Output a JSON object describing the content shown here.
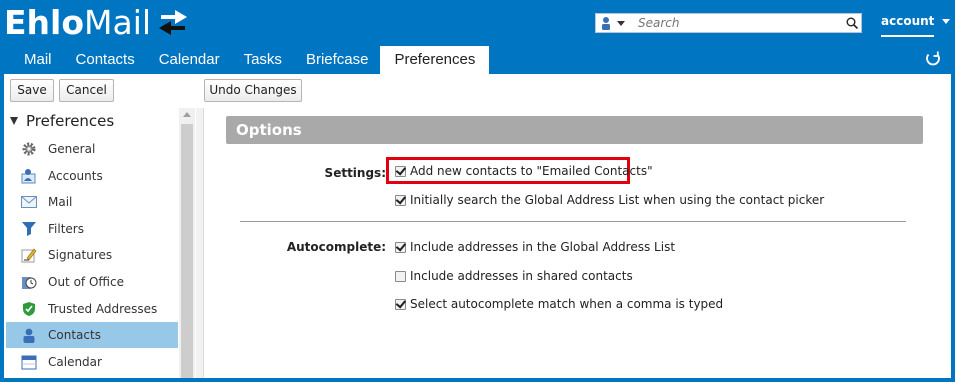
{
  "app": {
    "logo_text_bold": "Ehlo",
    "logo_text_thin": "Mail",
    "brand_color": "#0075c2"
  },
  "search": {
    "placeholder": "Search"
  },
  "account": {
    "label": "account"
  },
  "tabs": [
    {
      "label": "Mail"
    },
    {
      "label": "Contacts"
    },
    {
      "label": "Calendar"
    },
    {
      "label": "Tasks"
    },
    {
      "label": "Briefcase"
    },
    {
      "label": "Preferences",
      "active": true
    }
  ],
  "toolbar": {
    "save_label": "Save",
    "cancel_label": "Cancel",
    "undo_label": "Undo Changes"
  },
  "sidebar": {
    "title": "Preferences",
    "items": [
      {
        "label": "General",
        "icon": "gear-icon"
      },
      {
        "label": "Accounts",
        "icon": "accounts-icon"
      },
      {
        "label": "Mail",
        "icon": "envelope-icon"
      },
      {
        "label": "Filters",
        "icon": "filter-icon"
      },
      {
        "label": "Signatures",
        "icon": "pen-icon"
      },
      {
        "label": "Out of Office",
        "icon": "clock-icon"
      },
      {
        "label": "Trusted Addresses",
        "icon": "shield-icon"
      },
      {
        "label": "Contacts",
        "icon": "contact-icon",
        "selected": true
      },
      {
        "label": "Calendar",
        "icon": "calendar-icon"
      }
    ]
  },
  "options": {
    "title": "Options",
    "settings_label": "Settings:",
    "settings": [
      {
        "label": "Add new contacts to \"Emailed Contacts\"",
        "checked": true
      },
      {
        "label": "Initially search the Global Address List when using the contact picker",
        "checked": true
      }
    ],
    "autocomplete_label": "Autocomplete:",
    "autocomplete": [
      {
        "label": "Include addresses in the Global Address List",
        "checked": true
      },
      {
        "label": "Include addresses in shared contacts",
        "checked": false
      },
      {
        "label": "Select autocomplete match when a comma is typed",
        "checked": true
      }
    ],
    "highlight_color": "#e1000f"
  }
}
